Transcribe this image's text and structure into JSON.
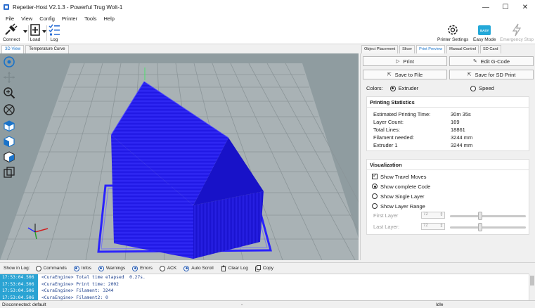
{
  "window": {
    "title": "Repetier-Host V2.1.3 - Powerful Trug Wolt-1",
    "minimize": "—",
    "maximize": "☐",
    "close": "✕"
  },
  "menu": [
    "File",
    "View",
    "Config",
    "Printer",
    "Tools",
    "Help"
  ],
  "toolbar": {
    "connect": "Connect",
    "load": "Load",
    "log": "Log",
    "printer_settings": "Printer Settings",
    "easy_mode": "Easy Mode",
    "easy_badge": "EASY",
    "emergency_stop": "Emergency Stop"
  },
  "left_tabs": [
    "3D View",
    "Temperature Curve"
  ],
  "right_tabs": [
    "Object Placement",
    "Slicer",
    "Print Preview",
    "Manual Control",
    "SD Card"
  ],
  "actions": {
    "print": "Print",
    "edit_gcode": "Edit G-Code",
    "save_to_file": "Save to File",
    "save_sd": "Save for SD Print"
  },
  "colors": {
    "label": "Colors:",
    "extruder": "Extruder",
    "speed": "Speed",
    "model": "#1f18e8",
    "background": "#8f9ca0",
    "accent": "#1a73c9"
  },
  "stats": {
    "title": "Printing Statistics",
    "rows": [
      {
        "label": "Estimated Printing Time:",
        "value": "30m 35s"
      },
      {
        "label": "Layer Count:",
        "value": "169"
      },
      {
        "label": "Total Lines:",
        "value": "18861"
      },
      {
        "label": "Filament needed:",
        "value": "3244 mm"
      },
      {
        "label": "Extruder 1",
        "value": "3244 mm"
      }
    ]
  },
  "visualization": {
    "title": "Visualization",
    "show_travel": "Show Travel Moves",
    "show_complete": "Show complete Code",
    "show_single": "Show Single Layer",
    "show_range": "Show Layer Range",
    "first_layer_label": "First Layer",
    "last_layer_label": "Last Layer:",
    "first_layer_value": "72",
    "last_layer_value": "72"
  },
  "log": {
    "show_in_log": "Show in Log:",
    "commands": "Commands",
    "infos": "Infos",
    "warnings": "Warnings",
    "errors": "Errors",
    "ack": "ACK",
    "auto_scroll": "Auto Scroll",
    "clear_log": "Clear Log",
    "copy": "Copy",
    "lines": [
      {
        "time": "17:53:04.506",
        "msg": "<CuraEngine> Total time elapsed  0.27s."
      },
      {
        "time": "17:53:04.506",
        "msg": "<CuraEngine> Print time: 2002"
      },
      {
        "time": "17:53:04.506",
        "msg": "<CuraEngine> Filament: 3244"
      },
      {
        "time": "17:53:04.506",
        "msg": "<CuraEngine> Filament2: 0"
      }
    ]
  },
  "status": {
    "left": "Disconnected: default",
    "dash": "-",
    "right": "Idle"
  }
}
